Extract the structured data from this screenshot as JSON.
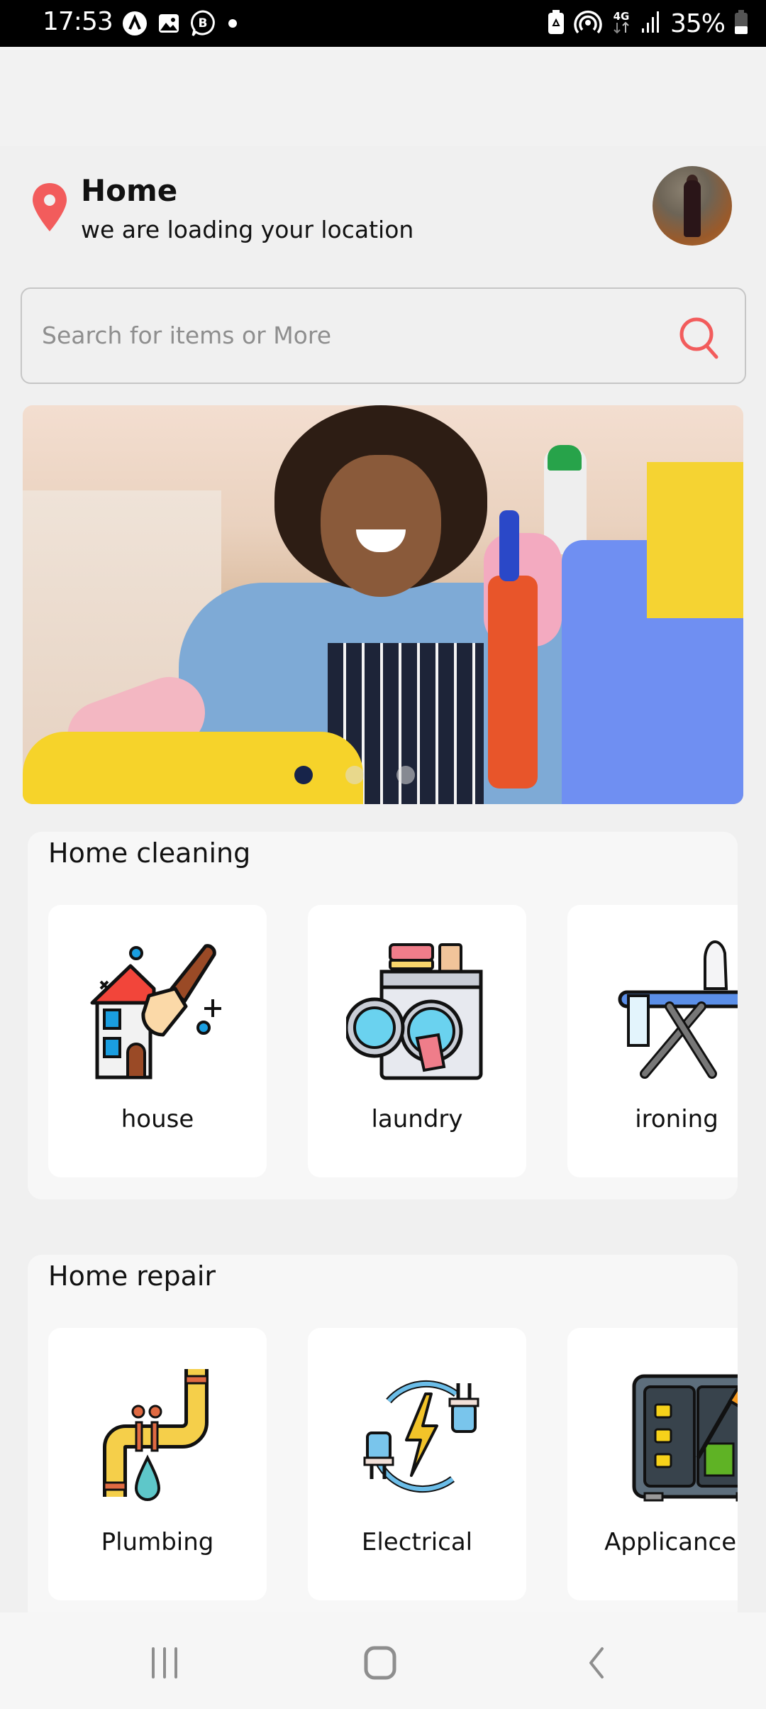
{
  "status_bar": {
    "time": "17:53",
    "left_icons": [
      "app-a-icon",
      "gallery-icon",
      "business-chat-icon",
      "notification-dot-icon"
    ],
    "right_icons": [
      "battery-saver-icon",
      "hotspot-icon",
      "4g-data-icon",
      "signal-icon"
    ],
    "network": "4G",
    "battery_percent": "35%"
  },
  "header": {
    "location_title": "Home",
    "location_subtitle": "we are loading your location",
    "accent_color": "#f25c5c"
  },
  "search": {
    "placeholder": "Search for items or More"
  },
  "banner": {
    "slide_count": 3,
    "active_slide": 1
  },
  "sections": [
    {
      "title": "Home cleaning",
      "items": [
        {
          "label": "house",
          "icon": "house-cleaning-icon"
        },
        {
          "label": "laundry",
          "icon": "washing-machine-icon"
        },
        {
          "label": "ironing",
          "icon": "ironing-board-icon"
        }
      ]
    },
    {
      "title": "Home repair",
      "items": [
        {
          "label": "Plumbing",
          "icon": "pipe-leak-icon"
        },
        {
          "label": "Electrical",
          "icon": "electric-plug-icon"
        },
        {
          "label": "Applicances",
          "icon": "appliance-repair-icon"
        }
      ]
    }
  ],
  "nav_bar": {
    "buttons": [
      "recent-apps",
      "home",
      "back"
    ]
  }
}
